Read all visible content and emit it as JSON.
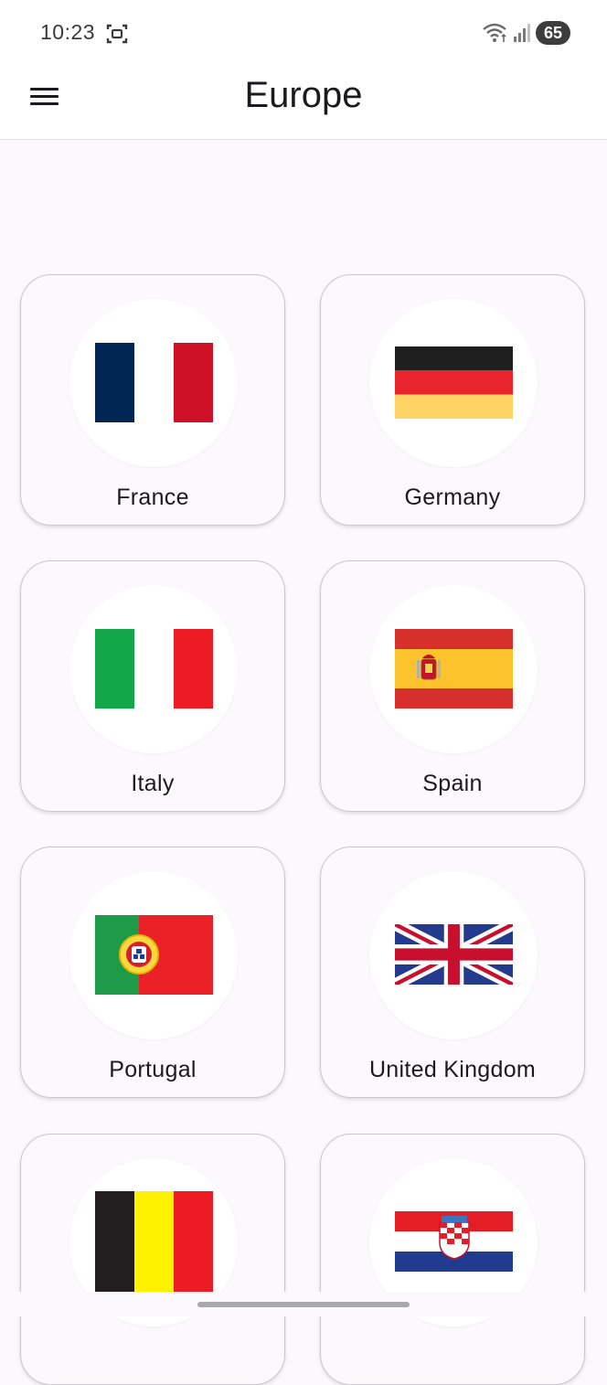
{
  "status_bar": {
    "time": "10:23",
    "battery_level": "65",
    "icons": [
      "screenshot-icon",
      "wifi-icon",
      "signal-icon",
      "battery-icon"
    ]
  },
  "app_bar": {
    "title": "Europe",
    "menu_icon": "hamburger-menu-icon"
  },
  "countries": [
    {
      "name": "France",
      "flag_icon": "france-flag"
    },
    {
      "name": "Germany",
      "flag_icon": "germany-flag"
    },
    {
      "name": "Italy",
      "flag_icon": "italy-flag"
    },
    {
      "name": "Spain",
      "flag_icon": "spain-flag"
    },
    {
      "name": "Portugal",
      "flag_icon": "portugal-flag"
    },
    {
      "name": "United Kingdom",
      "flag_icon": "united-kingdom-flag"
    },
    {
      "name": "",
      "flag_icon": "belgium-flag"
    },
    {
      "name": "",
      "flag_icon": "croatia-flag"
    }
  ],
  "colors": {
    "background": "#fbf9fb",
    "card_border": "#c9c7cc",
    "text": "#1b1b1f"
  }
}
